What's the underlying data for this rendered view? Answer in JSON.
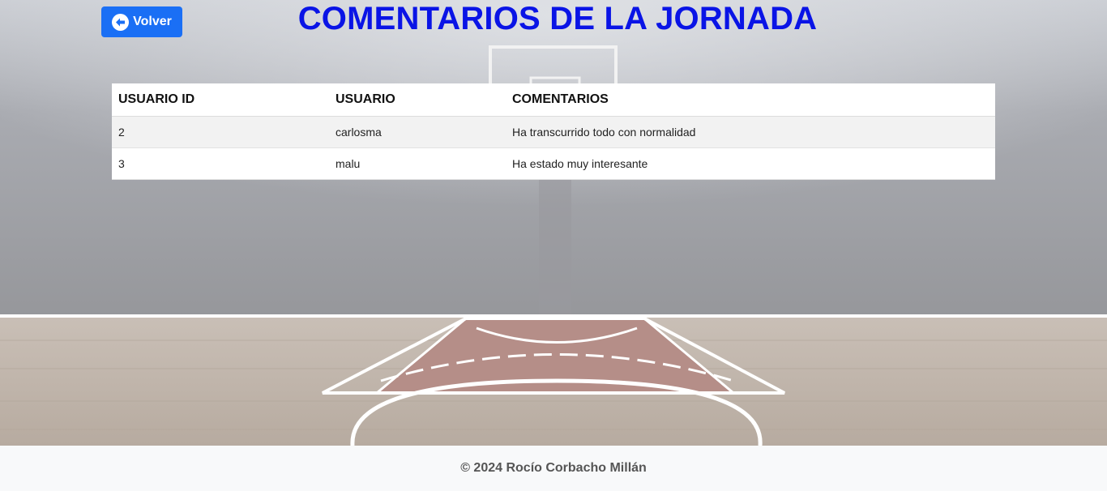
{
  "header": {
    "back_label": "Volver",
    "title": "COMENTARIOS DE LA JORNADA"
  },
  "table": {
    "columns": [
      "USUARIO ID",
      "USUARIO",
      "COMENTARIOS"
    ],
    "rows": [
      [
        "2",
        "carlosma",
        "Ha transcurrido todo con normalidad"
      ],
      [
        "3",
        "malu",
        "Ha estado muy interesante"
      ]
    ]
  },
  "footer": {
    "text": "© 2024 Rocío Corbacho Millán"
  },
  "colors": {
    "title": "#0a14e6",
    "button": "#1a6ff5",
    "footer_bg": "#f8f9fa"
  },
  "icons": {
    "back": "arrow-circle-left-icon"
  }
}
